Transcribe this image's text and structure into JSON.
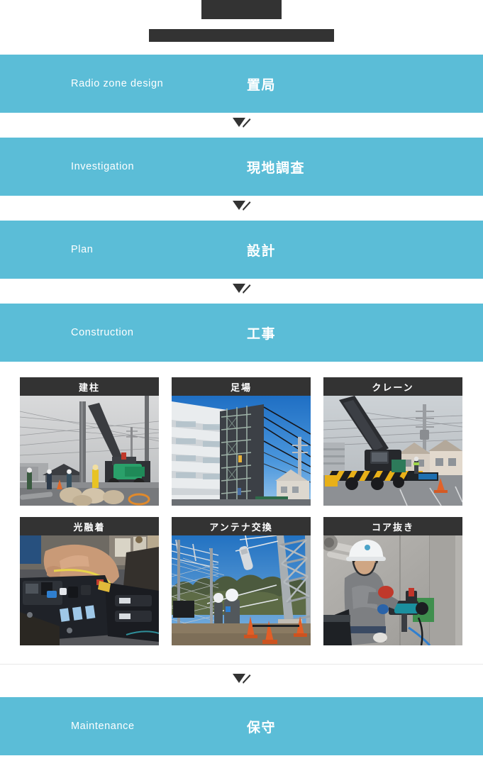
{
  "page": {
    "title_redacted": true,
    "accent_color": "#5bbdd7",
    "caption_bar_color": "#333333",
    "background_color": "#ffffff"
  },
  "header": {
    "title_block_label": "redacted-title-block",
    "subtitle_block_label": "redacted-subtitle-block"
  },
  "flow": {
    "arrow_icon": "down-arrow-icon",
    "steps": [
      {
        "en": "Radio zone design",
        "jp": "置局"
      },
      {
        "en": "Investigation",
        "jp": "現地調査"
      },
      {
        "en": "Plan",
        "jp": "設計"
      },
      {
        "en": "Construction",
        "jp": "工事"
      },
      {
        "en": "Maintenance",
        "jp": "保守"
      }
    ]
  },
  "gallery": {
    "cards": [
      {
        "caption": "建柱",
        "photo": "utility-pole-erection-photo"
      },
      {
        "caption": "足場",
        "photo": "scaffolding-building-photo"
      },
      {
        "caption": "クレーン",
        "photo": "mobile-crane-truck-photo"
      },
      {
        "caption": "光融着",
        "photo": "optical-fiber-fusion-splicer-photo"
      },
      {
        "caption": "アンテナ交換",
        "photo": "antenna-replacement-tower-photo"
      },
      {
        "caption": "コア抜き",
        "photo": "core-drilling-worker-photo"
      }
    ]
  }
}
